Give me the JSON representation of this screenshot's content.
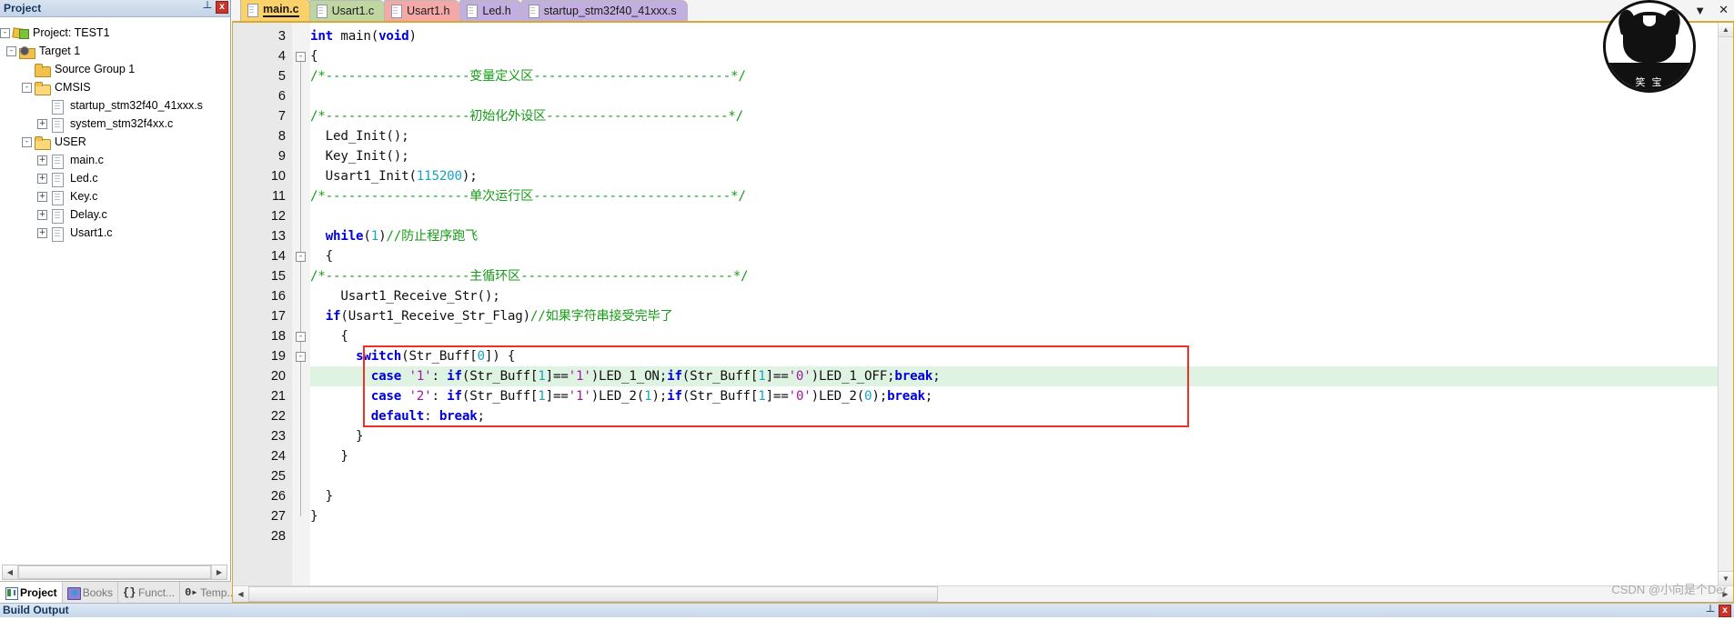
{
  "project_panel": {
    "title": "Project",
    "pin_icon": "pin-icon",
    "close_label": "x",
    "tree": [
      {
        "indent": 0,
        "expander": "-",
        "icon": "proj",
        "label": "Project: TEST1"
      },
      {
        "indent": 1,
        "expander": "-",
        "icon": "target",
        "label": "Target 1"
      },
      {
        "indent": 2,
        "expander": "",
        "icon": "folder",
        "label": "Source Group 1"
      },
      {
        "indent": 2,
        "expander": "-",
        "icon": "folder",
        "label": "CMSIS"
      },
      {
        "indent": 3,
        "expander": "",
        "icon": "file",
        "label": "startup_stm32f40_41xxx.s"
      },
      {
        "indent": 3,
        "expander": "+",
        "icon": "file",
        "label": "system_stm32f4xx.c"
      },
      {
        "indent": 2,
        "expander": "-",
        "icon": "folder",
        "label": "USER"
      },
      {
        "indent": 3,
        "expander": "+",
        "icon": "file",
        "label": "main.c"
      },
      {
        "indent": 3,
        "expander": "+",
        "icon": "file",
        "label": "Led.c"
      },
      {
        "indent": 3,
        "expander": "+",
        "icon": "file",
        "label": "Key.c"
      },
      {
        "indent": 3,
        "expander": "+",
        "icon": "file",
        "label": "Delay.c"
      },
      {
        "indent": 3,
        "expander": "+",
        "icon": "file",
        "label": "Usart1.c"
      }
    ],
    "bottom_tabs": [
      {
        "label": "Project",
        "icon": "project-icon",
        "active": true
      },
      {
        "label": "Books",
        "icon": "books-icon",
        "active": false
      },
      {
        "label": "Funct...",
        "icon": "functions-icon",
        "active": false
      },
      {
        "label": "Temp...",
        "icon": "templates-icon",
        "active": false
      }
    ]
  },
  "editor": {
    "tabs": [
      {
        "label": "main.c",
        "color": "#fbd269",
        "active": true
      },
      {
        "label": "Usart1.c",
        "color": "#bfd6a0",
        "active": false
      },
      {
        "label": "Usart1.h",
        "color": "#f4a9a6",
        "active": false
      },
      {
        "label": "Led.h",
        "color": "#c2aee0",
        "active": false
      },
      {
        "label": "startup_stm32f40_41xxx.s",
        "color": "#c2aee0",
        "active": false
      }
    ],
    "first_line_number": 3,
    "lines": [
      {
        "n": 3,
        "fold": "",
        "segs": [
          {
            "t": "int ",
            "c": "kw"
          },
          {
            "t": "main",
            "c": "pl"
          },
          {
            "t": "(",
            "c": "pl"
          },
          {
            "t": "void",
            "c": "kw"
          },
          {
            "t": ")",
            "c": "pl"
          }
        ]
      },
      {
        "n": 4,
        "fold": "-",
        "segs": [
          {
            "t": "{",
            "c": "pl"
          }
        ]
      },
      {
        "n": 5,
        "fold": "",
        "segs": [
          {
            "t": "/*-------------------变量定义区--------------------------*/",
            "c": "cmt"
          }
        ]
      },
      {
        "n": 6,
        "fold": "",
        "segs": []
      },
      {
        "n": 7,
        "fold": "",
        "segs": [
          {
            "t": "/*-------------------初始化外设区------------------------*/",
            "c": "cmt"
          }
        ]
      },
      {
        "n": 8,
        "fold": "",
        "segs": [
          {
            "t": "  Led_Init();",
            "c": "pl"
          }
        ]
      },
      {
        "n": 9,
        "fold": "",
        "segs": [
          {
            "t": "  Key_Init();",
            "c": "pl"
          }
        ]
      },
      {
        "n": 10,
        "fold": "",
        "segs": [
          {
            "t": "  Usart1_Init(",
            "c": "pl"
          },
          {
            "t": "115200",
            "c": "num"
          },
          {
            "t": ");",
            "c": "pl"
          }
        ]
      },
      {
        "n": 11,
        "fold": "",
        "segs": [
          {
            "t": "/*-------------------单次运行区--------------------------*/",
            "c": "cmt"
          }
        ]
      },
      {
        "n": 12,
        "fold": "",
        "segs": []
      },
      {
        "n": 13,
        "fold": "",
        "segs": [
          {
            "t": "  ",
            "c": "pl"
          },
          {
            "t": "while",
            "c": "kw"
          },
          {
            "t": "(",
            "c": "pl"
          },
          {
            "t": "1",
            "c": "num"
          },
          {
            "t": ")",
            "c": "pl"
          },
          {
            "t": "//防止程序跑飞",
            "c": "cmt"
          }
        ]
      },
      {
        "n": 14,
        "fold": "-",
        "segs": [
          {
            "t": "  {",
            "c": "pl"
          }
        ]
      },
      {
        "n": 15,
        "fold": "",
        "segs": [
          {
            "t": "/*-------------------主循环区----------------------------*/",
            "c": "cmt"
          }
        ]
      },
      {
        "n": 16,
        "fold": "",
        "segs": [
          {
            "t": "    Usart1_Receive_Str();",
            "c": "pl"
          }
        ]
      },
      {
        "n": 17,
        "fold": "",
        "segs": [
          {
            "t": "  ",
            "c": "pl"
          },
          {
            "t": "if",
            "c": "kw"
          },
          {
            "t": "(Usart1_Receive_Str_Flag)",
            "c": "pl"
          },
          {
            "t": "//如果字符串接受完毕了",
            "c": "cmt"
          }
        ]
      },
      {
        "n": 18,
        "fold": "-",
        "segs": [
          {
            "t": "    {",
            "c": "pl"
          }
        ]
      },
      {
        "n": 19,
        "fold": "-",
        "segs": [
          {
            "t": "      ",
            "c": "pl"
          },
          {
            "t": "switch",
            "c": "kw"
          },
          {
            "t": "(Str_Buff[",
            "c": "pl"
          },
          {
            "t": "0",
            "c": "num"
          },
          {
            "t": "]) {",
            "c": "pl"
          }
        ]
      },
      {
        "n": 20,
        "fold": "",
        "highlight": true,
        "segs": [
          {
            "t": "        ",
            "c": "pl"
          },
          {
            "t": "case",
            "c": "kw"
          },
          {
            "t": " ",
            "c": "pl"
          },
          {
            "t": "'1'",
            "c": "chr"
          },
          {
            "t": ": ",
            "c": "pl"
          },
          {
            "t": "if",
            "c": "kw"
          },
          {
            "t": "(Str_Buff[",
            "c": "pl"
          },
          {
            "t": "1",
            "c": "num"
          },
          {
            "t": "]==",
            "c": "pl"
          },
          {
            "t": "'1'",
            "c": "chr"
          },
          {
            "t": ")LED_1_ON;",
            "c": "pl"
          },
          {
            "t": "if",
            "c": "kw"
          },
          {
            "t": "(Str_Buff[",
            "c": "pl"
          },
          {
            "t": "1",
            "c": "num"
          },
          {
            "t": "]==",
            "c": "pl"
          },
          {
            "t": "'0'",
            "c": "chr"
          },
          {
            "t": ")LED_1_OFF;",
            "c": "pl"
          },
          {
            "t": "break",
            "c": "kw"
          },
          {
            "t": ";",
            "c": "pl"
          }
        ]
      },
      {
        "n": 21,
        "fold": "",
        "segs": [
          {
            "t": "        ",
            "c": "pl"
          },
          {
            "t": "case",
            "c": "kw"
          },
          {
            "t": " ",
            "c": "pl"
          },
          {
            "t": "'2'",
            "c": "chr"
          },
          {
            "t": ": ",
            "c": "pl"
          },
          {
            "t": "if",
            "c": "kw"
          },
          {
            "t": "(Str_Buff[",
            "c": "pl"
          },
          {
            "t": "1",
            "c": "num"
          },
          {
            "t": "]==",
            "c": "pl"
          },
          {
            "t": "'1'",
            "c": "chr"
          },
          {
            "t": ")LED_2(",
            "c": "pl"
          },
          {
            "t": "1",
            "c": "num"
          },
          {
            "t": ");",
            "c": "pl"
          },
          {
            "t": "if",
            "c": "kw"
          },
          {
            "t": "(Str_Buff[",
            "c": "pl"
          },
          {
            "t": "1",
            "c": "num"
          },
          {
            "t": "]==",
            "c": "pl"
          },
          {
            "t": "'0'",
            "c": "chr"
          },
          {
            "t": ")LED_2(",
            "c": "pl"
          },
          {
            "t": "0",
            "c": "num"
          },
          {
            "t": ");",
            "c": "pl"
          },
          {
            "t": "break",
            "c": "kw"
          },
          {
            "t": ";",
            "c": "pl"
          }
        ]
      },
      {
        "n": 22,
        "fold": "",
        "segs": [
          {
            "t": "        ",
            "c": "pl"
          },
          {
            "t": "default",
            "c": "kw"
          },
          {
            "t": ": ",
            "c": "pl"
          },
          {
            "t": "break",
            "c": "kw"
          },
          {
            "t": ";",
            "c": "pl"
          }
        ]
      },
      {
        "n": 23,
        "fold": "",
        "segs": [
          {
            "t": "      }",
            "c": "pl"
          }
        ]
      },
      {
        "n": 24,
        "fold": "",
        "segs": [
          {
            "t": "    }",
            "c": "pl"
          }
        ]
      },
      {
        "n": 25,
        "fold": "",
        "segs": []
      },
      {
        "n": 26,
        "fold": "",
        "segs": [
          {
            "t": "  }",
            "c": "pl"
          }
        ]
      },
      {
        "n": 27,
        "fold": "",
        "segs": [
          {
            "t": "}",
            "c": "pl"
          }
        ]
      },
      {
        "n": 28,
        "fold": "",
        "segs": []
      }
    ]
  },
  "window": {
    "dropdown_icon": "chevron-down-icon",
    "close_icon": "close-icon",
    "scroll_up_icon": "chevron-up-icon",
    "scroll_down_icon": "chevron-down-icon",
    "scroll_left_icon": "chevron-left-icon",
    "scroll_right_icon": "chevron-right-icon"
  },
  "avatar": {
    "name": "user-avatar",
    "band_text": "笑 宝"
  },
  "build_output": {
    "title": "Build Output",
    "pin_icon": "pin-icon",
    "close_label": "x"
  },
  "watermark": {
    "text": "CSDN @小向是个Der"
  },
  "colors": {
    "tab_accent": "#d9a938",
    "highlight_row": "#dff3e2",
    "red_box": "#ef3125",
    "comment_green": "#169c16",
    "keyword_blue": "#0000d8",
    "char_purple": "#a0199e",
    "number_cyan": "#1aa3c0"
  }
}
